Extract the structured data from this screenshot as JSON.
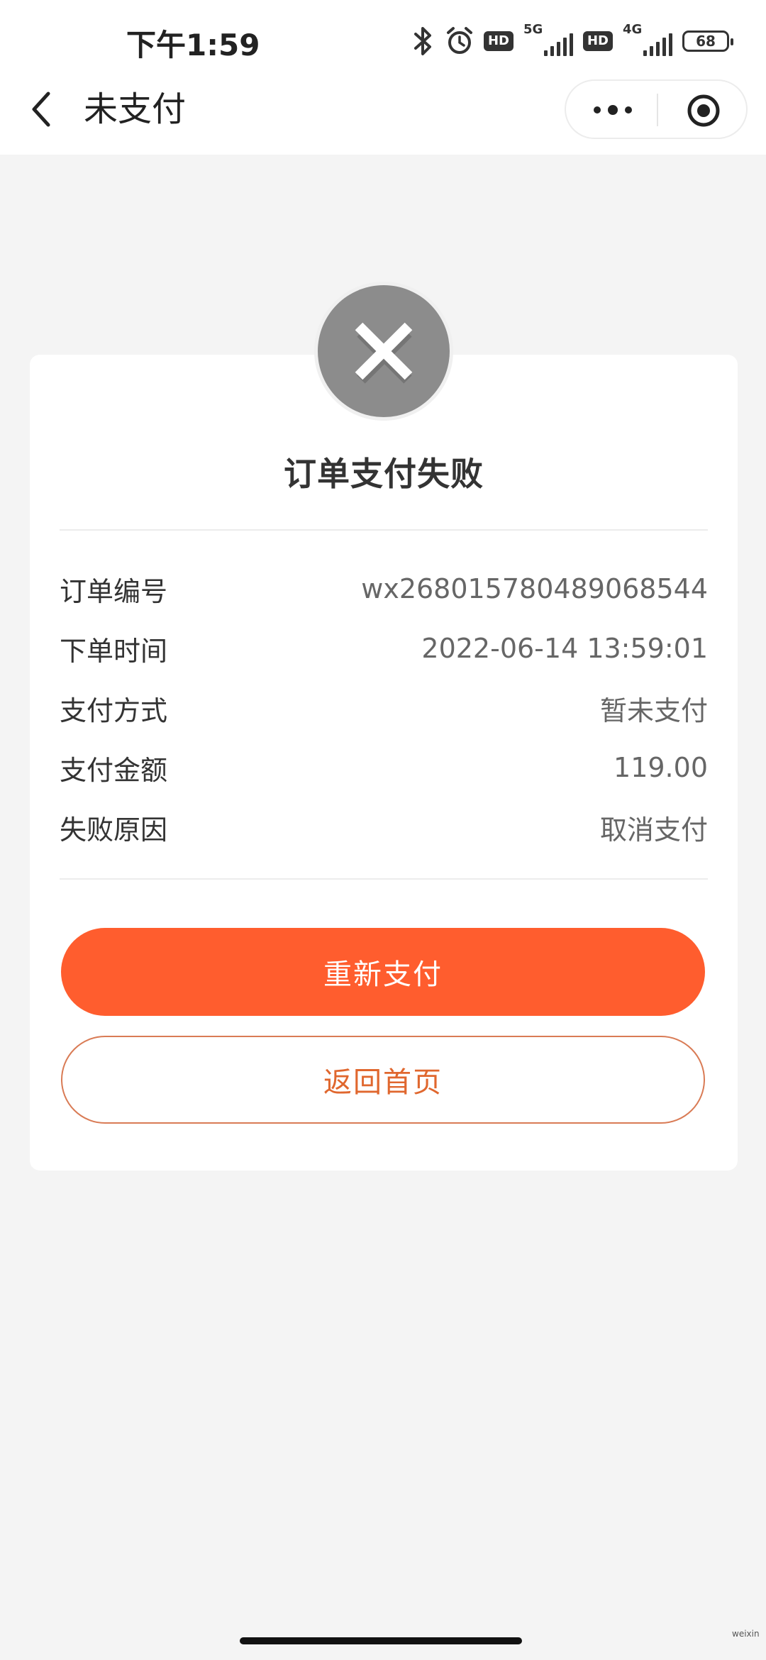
{
  "status_bar": {
    "time": "下午1:59",
    "hd_label": "HD",
    "network_1": "5G",
    "network_2": "4G",
    "battery": "68"
  },
  "nav": {
    "title": "未支付",
    "back_icon": "chevron-left-icon",
    "more_icon": "more-dots-icon",
    "close_icon": "target-close-icon"
  },
  "result": {
    "icon": "close-x-icon",
    "icon_color": "#8c8c8c",
    "title": "订单支付失败"
  },
  "details": [
    {
      "label": "订单编号",
      "value": "wx268015780489068544"
    },
    {
      "label": "下单时间",
      "value": "2022-06-14 13:59:01"
    },
    {
      "label": "支付方式",
      "value": "暂未支付"
    },
    {
      "label": "支付金额",
      "value": "119.00"
    },
    {
      "label": "失败原因",
      "value": "取消支付"
    }
  ],
  "actions": {
    "repay_label": "重新支付",
    "home_label": "返回首页",
    "primary_color": "#ff5d2e",
    "secondary_color": "#e0672e"
  },
  "watermark": "weixin"
}
